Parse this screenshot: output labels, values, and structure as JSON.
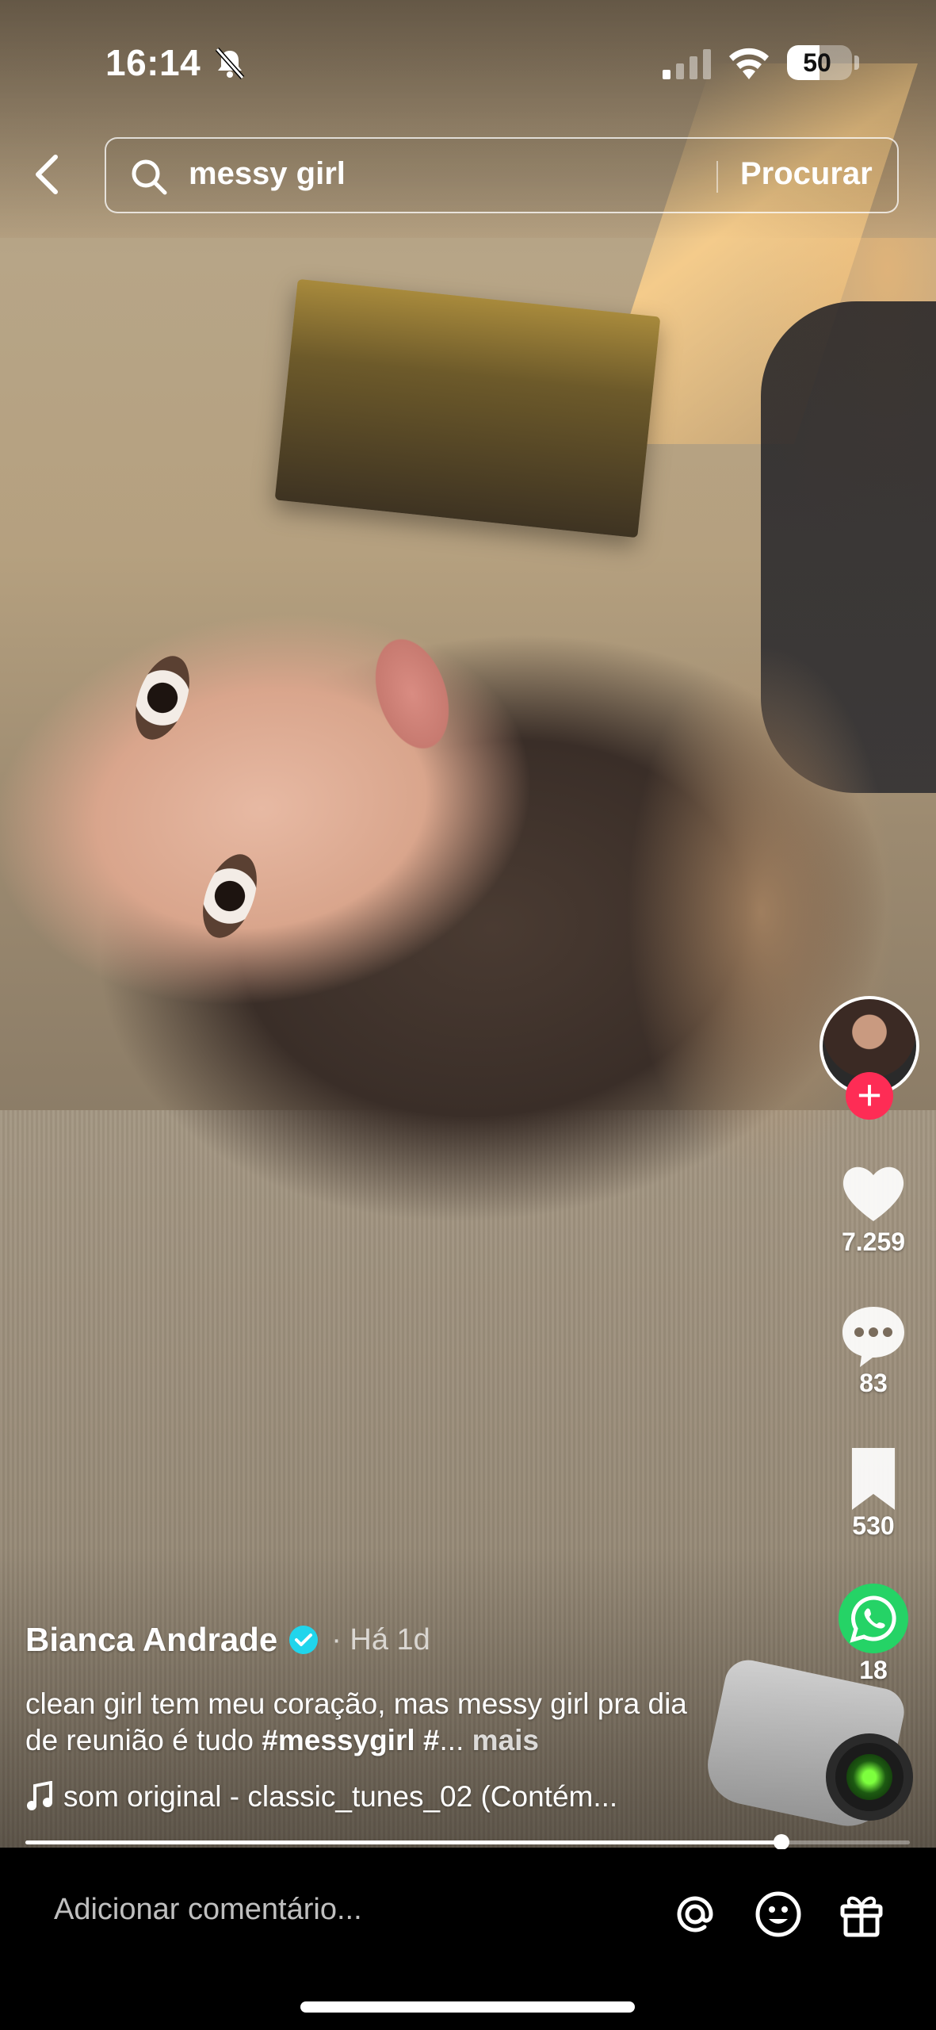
{
  "status_bar": {
    "time": "16:14",
    "battery_text": "50",
    "battery_level": 0.5,
    "icons": [
      "bell-slash-icon",
      "signal-icon",
      "wifi-icon",
      "battery-icon"
    ]
  },
  "search": {
    "query": "messy girl",
    "submit_label": "Procurar",
    "icons": [
      "back-arrow-icon",
      "search-icon"
    ]
  },
  "rail": {
    "likes": "7.259",
    "comments": "83",
    "saves": "530",
    "shares": "18",
    "follow_symbol": "+",
    "icons": [
      "heart-icon",
      "comment-icon",
      "bookmark-icon",
      "whatsapp-icon",
      "music-disc-icon"
    ]
  },
  "post": {
    "author": "Bianca Andrade",
    "time": "· Há 1d",
    "caption_text": "clean girl tem meu coração, mas messy girl pra dia de reunião é tudo ",
    "caption_tag": "#messygirl #",
    "caption_ellipsis": "... ",
    "caption_more": "mais",
    "sound": "som original - classic_tunes_02 (Contém..."
  },
  "progress": {
    "fraction": 0.855
  },
  "comment_bar": {
    "placeholder": "Adicionar comentário...",
    "icons": [
      "at-icon",
      "emoji-icon",
      "gift-icon"
    ]
  },
  "colors": {
    "accent_red": "#fe2c55",
    "verified_blue": "#20d5ec",
    "whatsapp_green": "#25d366"
  }
}
